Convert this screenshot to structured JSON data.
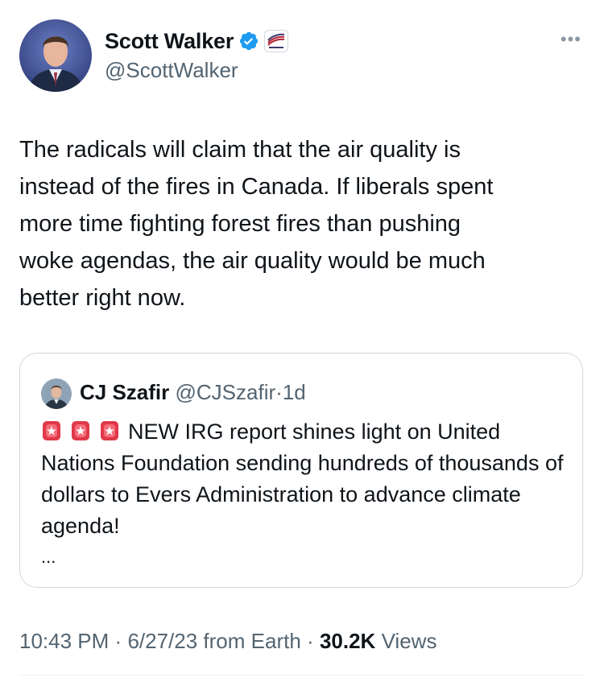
{
  "author": {
    "display_name": "Scott Walker",
    "handle": "@ScottWalker",
    "verified_icon": "verified-badge-icon",
    "affiliation_icon": "affiliation-flag-icon"
  },
  "more_label": "•••",
  "tweet_text": "The radicals will claim that the air quality is\ninstead of the fires in Canada. If liberals spent\nmore time fighting forest fires than pushing\nwoke agendas, the air quality would be much\nbetter right now.",
  "quote": {
    "display_name": "CJ Szafir",
    "handle": "@CJSzafir",
    "separator": "·",
    "time": "1d",
    "siren_icon": "police-light-icon",
    "text": "NEW IRG report shines light on United Nations Foundation sending hundreds of thousands of dollars to Evers Administration to advance climate agenda!",
    "truncation": "..."
  },
  "meta": {
    "time": "10:43 PM",
    "sep1": "·",
    "date": "6/27/23",
    "source": "from Earth",
    "sep2": "·",
    "views_count": "30.2K",
    "views_label": "Views"
  },
  "colors": {
    "verified_blue": "#1d9bf0",
    "secondary_text": "#536471",
    "primary_text": "#0f1419",
    "border": "#cfd9de"
  }
}
